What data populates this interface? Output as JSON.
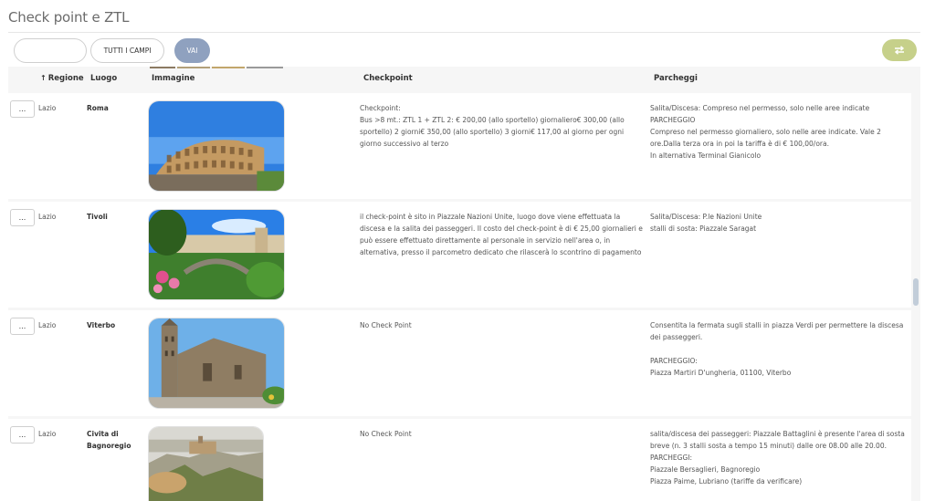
{
  "page": {
    "title": "Check point e ZTL"
  },
  "toolbar": {
    "search_placeholder": "",
    "field_select_label": "TUTTI I CAMPI",
    "go_label": "VAI",
    "reset_icon": "swap-arrows-icon"
  },
  "colors": {
    "go_button": "#8fa1bf",
    "reset_button": "#c6d08a",
    "scroll_thumb": "#c2cdd9"
  },
  "table": {
    "headers": {
      "regione": "Regione",
      "luogo": "Luogo",
      "immagine": "Immagine",
      "checkpoint": "Checkpoint",
      "parcheggi": "Parcheggi"
    },
    "sorted_column": "regione",
    "sort_icon": "arrow-up-icon",
    "rows": [
      {
        "menu": "...",
        "regione": "Lazio",
        "luogo": "Roma",
        "image": "colosseum-photo",
        "checkpoint": [
          "Checkpoint:",
          "Bus >8 mt.: ZTL 1 + ZTL 2: € 200,00 (allo sportello) giornaliero€ 300,00 (allo sportello) 2 giorni€ 350,00 (allo sportello) 3 giorni€ 117,00 al giorno per ogni giorno successivo al terzo"
        ],
        "parcheggi": [
          "Salita/Discesa: Compreso nel permesso, solo nelle aree indicate",
          "PARCHEGGIO",
          "Compreso nel permesso giornaliero, solo nelle aree indicate. Vale 2 ore.Dalla terza ora in poi la tariffa è di € 100,00/ora.",
          "In alternativa Terminal Gianicolo"
        ]
      },
      {
        "menu": "...",
        "regione": "Lazio",
        "luogo": "Tivoli",
        "image": "tivoli-garden-photo",
        "checkpoint": [
          "il check-point è sito in Piazzale Nazioni Unite, luogo dove viene effettuata la discesa e la salita dei passeggeri. Il costo del check-point è di € 25,00 giornalieri e può essere effettuato direttamente al personale in servizio nell'area o, in alternativa, presso il parcometro dedicato che rilascerà lo scontrino di pagamento"
        ],
        "parcheggi": [
          "Salita/Discesa: P.le Nazioni Unite",
          "stalli di sosta: Piazzale Saragat"
        ]
      },
      {
        "menu": "...",
        "regione": "Lazio",
        "luogo": "Viterbo",
        "image": "viterbo-cathedral-photo",
        "checkpoint": [
          "No Check Point"
        ],
        "parcheggi": [
          "Consentita la fermata sugli stalli in piazza Verdi per permettere la discesa dei passeggeri.",
          "",
          "PARCHEGGIO:",
          "Piazza Martiri D'ungheria, 01100, Viterbo"
        ]
      },
      {
        "menu": "...",
        "regione": "Lazio",
        "luogo": "Civita di Bagnoregio",
        "image": "civita-bagnoregio-photo",
        "checkpoint": [
          "No Check Point"
        ],
        "parcheggi": [
          "salita/discesa dei passeggeri: Piazzale Battaglini è presente l'area di sosta breve (n. 3 stalli sosta a tempo 15 minuti) dalle ore 08.00 alle 20.00.",
          "PARCHEGGI:",
          "Piazzale Bersaglieri, Bagnoregio",
          "Piazza Paime, Lubriano (tariffe da verificare)"
        ]
      }
    ]
  }
}
